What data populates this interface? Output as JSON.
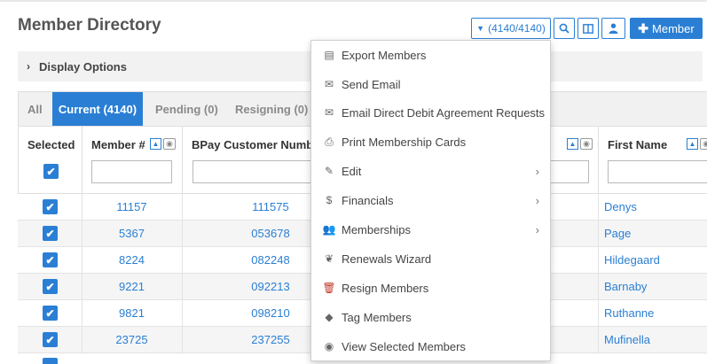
{
  "page": {
    "title": "Member Directory"
  },
  "toolbar": {
    "count_label": "(4140/4140)",
    "add_member_label": "Member",
    "accent": "#2a7fd4"
  },
  "display_options": {
    "label": "Display Options"
  },
  "tabs": [
    {
      "label": "All",
      "active": false
    },
    {
      "label": "Current (4140)",
      "active": true
    },
    {
      "label": "Pending (0)",
      "active": false
    },
    {
      "label": "Resigning (0)",
      "active": false
    }
  ],
  "columns": {
    "selected": "Selected",
    "member_no": "Member #",
    "bpay": "BPay Customer Number",
    "first_name": "First Name"
  },
  "rows": [
    {
      "member_no": "11157",
      "bpay": "111575",
      "first_name": "Denys"
    },
    {
      "member_no": "5367",
      "bpay": "053678",
      "first_name": "Page"
    },
    {
      "member_no": "8224",
      "bpay": "082248",
      "first_name": "Hildegaard"
    },
    {
      "member_no": "9221",
      "bpay": "092213",
      "first_name": "Barnaby"
    },
    {
      "member_no": "9821",
      "bpay": "098210",
      "first_name": "Ruthanne"
    },
    {
      "member_no": "23725",
      "bpay": "237255",
      "first_name": "Mufinella"
    }
  ],
  "menu": {
    "items": [
      {
        "label": "Export Members",
        "icon": "file-export-icon",
        "submenu": false
      },
      {
        "label": "Send Email",
        "icon": "envelope-icon",
        "submenu": false
      },
      {
        "label": "Email Direct Debit Agreement Requests",
        "icon": "envelope-icon",
        "submenu": false
      },
      {
        "label": "Print Membership Cards",
        "icon": "print-icon",
        "submenu": false
      },
      {
        "label": "Edit",
        "icon": "pencil-icon",
        "submenu": true
      },
      {
        "label": "Financials",
        "icon": "dollar-icon",
        "submenu": true
      },
      {
        "label": "Memberships",
        "icon": "users-icon",
        "submenu": true
      },
      {
        "label": "Renewals Wizard",
        "icon": "leaf-icon",
        "submenu": false
      },
      {
        "label": "Resign Members",
        "icon": "trash-icon",
        "submenu": false
      },
      {
        "label": "Tag Members",
        "icon": "tag-icon",
        "submenu": false
      },
      {
        "label": "View Selected Members",
        "icon": "eye-icon",
        "submenu": false
      }
    ]
  }
}
